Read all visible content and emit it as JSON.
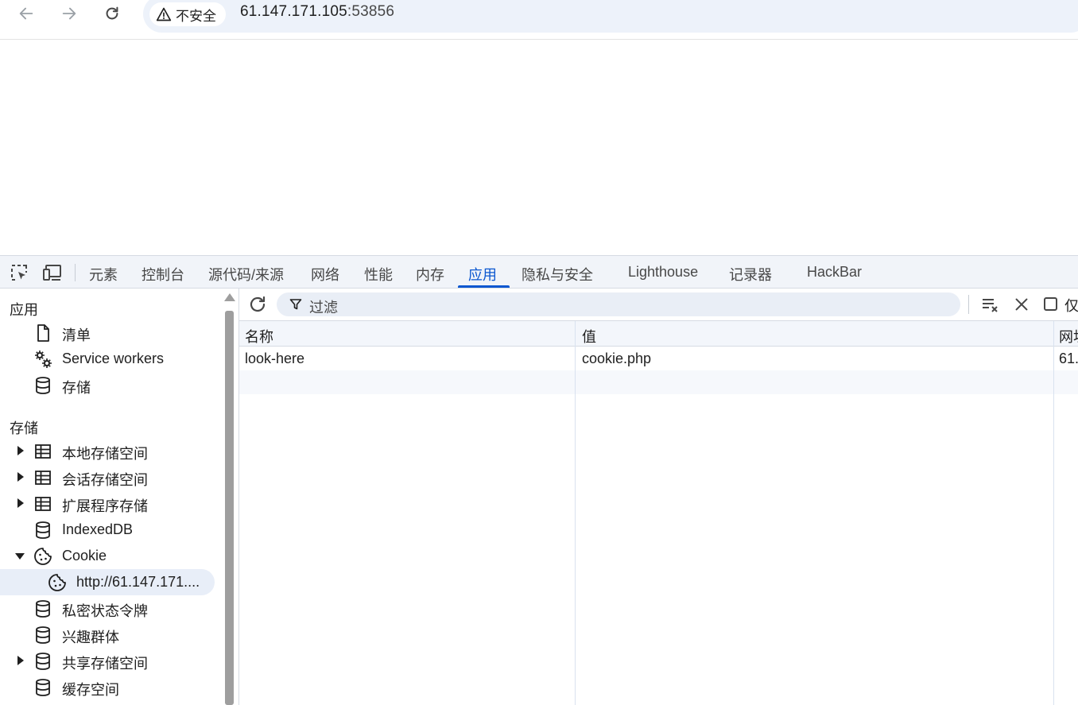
{
  "browser": {
    "back_icon": "arrow-left-icon",
    "forward_icon": "arrow-right-icon",
    "reload_icon": "reload-icon",
    "security_label": "不安全",
    "url_host": "61.147.171.105",
    "url_port": ":53856"
  },
  "devtools": {
    "tabs": [
      {
        "label": "元素"
      },
      {
        "label": "控制台"
      },
      {
        "label": "源代码/来源"
      },
      {
        "label": "网络"
      },
      {
        "label": "性能"
      },
      {
        "label": "内存"
      },
      {
        "label": "应用"
      },
      {
        "label": "隐私与安全"
      },
      {
        "label": "Lighthouse"
      },
      {
        "label": "记录器"
      },
      {
        "label": "HackBar"
      }
    ],
    "active_tab": "应用",
    "accent_color": "#0b57d0"
  },
  "sidebar": {
    "section_app": "应用",
    "app_items": [
      {
        "label": "清单",
        "icon": "file-icon"
      },
      {
        "label": "Service workers",
        "icon": "gears-icon"
      },
      {
        "label": "存储",
        "icon": "database-icon"
      }
    ],
    "section_storage": "存储",
    "storage_items": [
      {
        "label": "本地存储空间",
        "icon": "table-icon"
      },
      {
        "label": "会话存储空间",
        "icon": "table-icon"
      },
      {
        "label": "扩展程序存储",
        "icon": "table-icon"
      },
      {
        "label": "IndexedDB",
        "icon": "database-icon"
      },
      {
        "label": "Cookie",
        "icon": "cookie-icon"
      },
      {
        "label": "http://61.147.171....",
        "icon": "cookie-icon"
      },
      {
        "label": "私密状态令牌",
        "icon": "database-icon"
      },
      {
        "label": "兴趣群体",
        "icon": "database-icon"
      },
      {
        "label": "共享存储空间",
        "icon": "database-icon"
      },
      {
        "label": "缓存空间",
        "icon": "database-icon"
      }
    ]
  },
  "cookies": {
    "filter_placeholder": "过滤",
    "only_label": "仅",
    "columns": [
      "名称",
      "值",
      "网址"
    ],
    "col3_visible": "网址",
    "rows": [
      {
        "name": "look-here",
        "value": "cookie.php",
        "domain": "61."
      }
    ]
  }
}
